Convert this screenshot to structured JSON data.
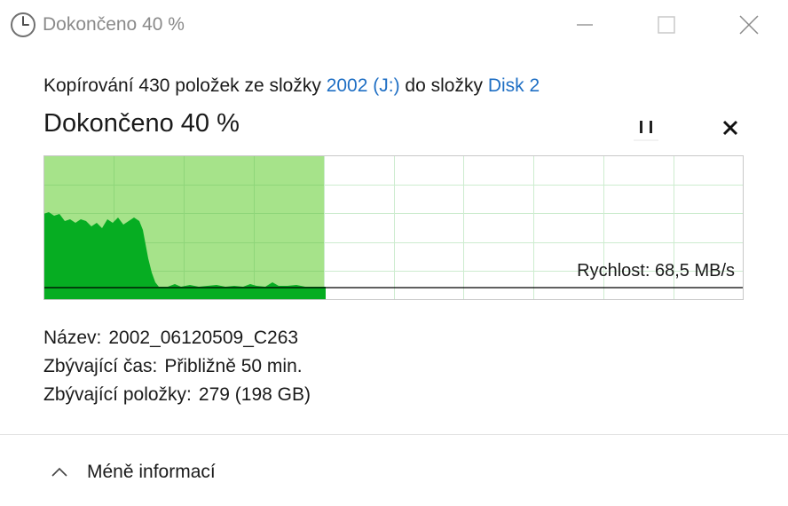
{
  "window": {
    "title": "Dokončeno 40 %",
    "icon": "clock-icon",
    "controls": [
      "minimize-icon",
      "maximize-icon",
      "close-icon"
    ]
  },
  "copy": {
    "prefix": "Kopírování 430 položek ze složky",
    "source": "2002 (J:)",
    "middle": "do složky",
    "destination": "Disk 2"
  },
  "progress": {
    "title": "Dokončeno 40 %",
    "percent": 40,
    "pause_icon": "pause-icon",
    "cancel_icon": "close-icon"
  },
  "speed": {
    "label": "Rychlost: 68,5 MB/s"
  },
  "details": {
    "name_key": "Název:",
    "name_val": "2002_06120509_C263",
    "time_key": "Zbývající čas:",
    "time_val": "Přibližně 50 min.",
    "items_key": "Zbývající položky:",
    "items_val": "279 (198 GB)"
  },
  "footer": {
    "less_info": "Méně informací",
    "chevron_icon": "chevron-up-icon"
  },
  "colors": {
    "accent": "#1f6fc4",
    "progress_fill": "#a6e38a",
    "speed_fill": "#06ad22",
    "grid": "#cdeccf"
  }
}
